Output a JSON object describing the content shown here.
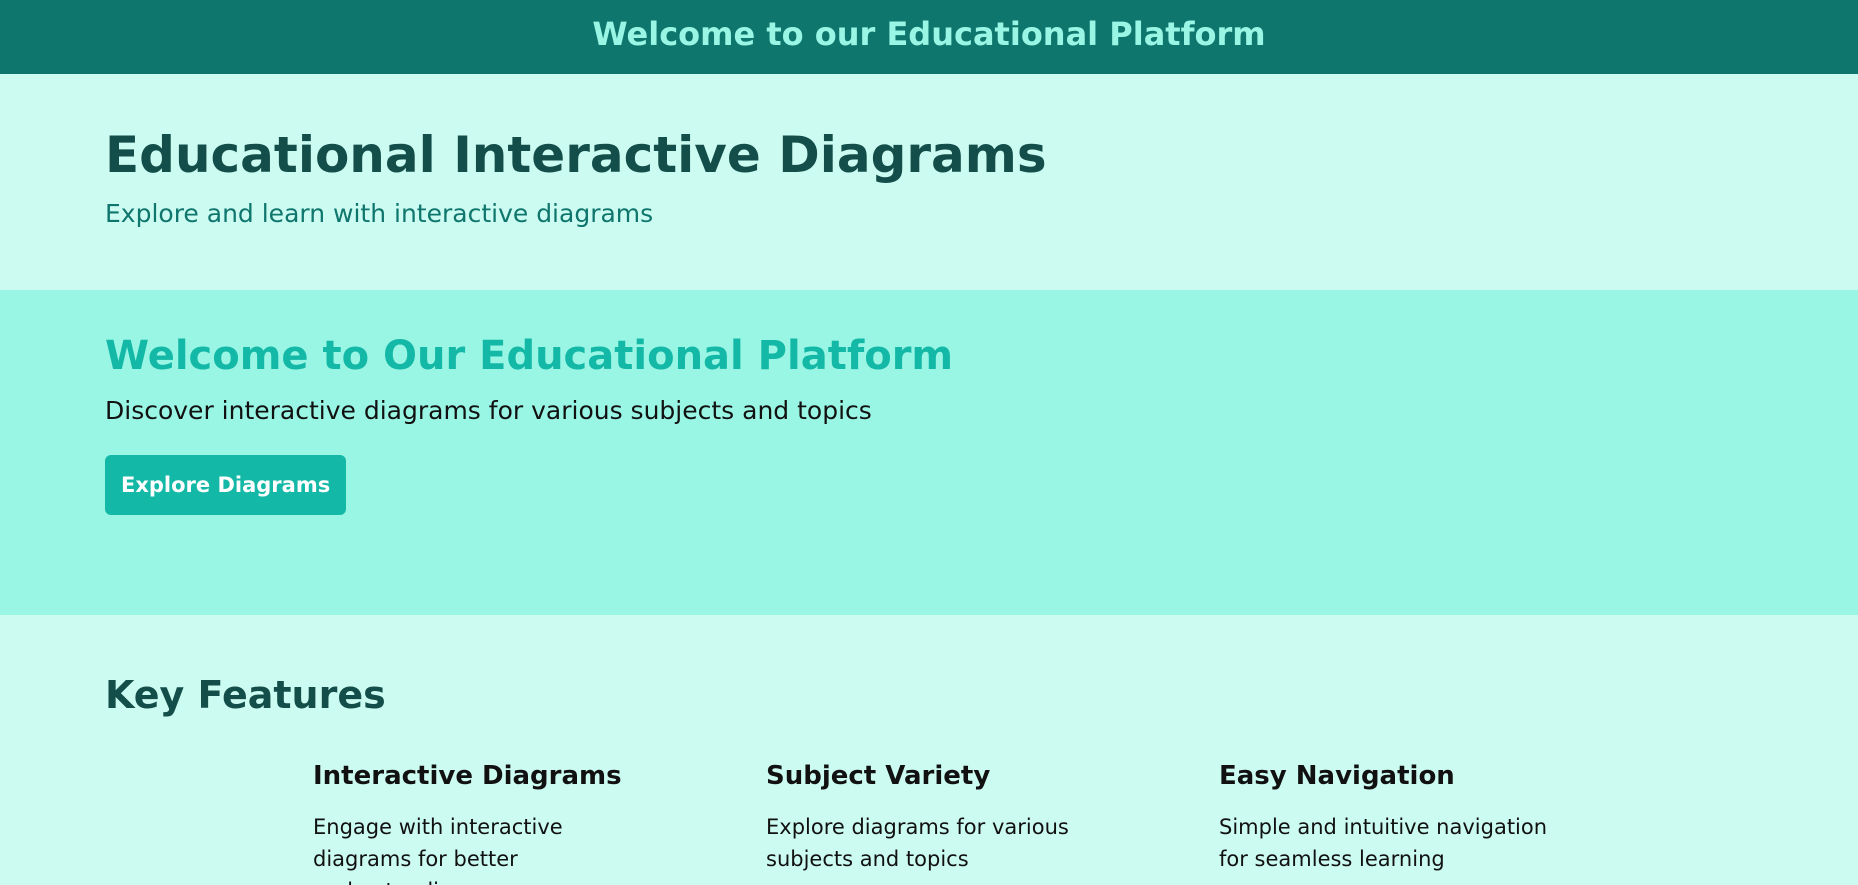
{
  "topbar": {
    "title": "Welcome to our Educational Platform"
  },
  "header": {
    "title": "Educational Interactive Diagrams",
    "subtitle": "Explore and learn with interactive diagrams"
  },
  "hero": {
    "title": "Welcome to Our Educational Platform",
    "text": "Discover interactive diagrams for various subjects and topics",
    "button_label": "Explore Diagrams"
  },
  "features": {
    "title": "Key Features",
    "items": [
      {
        "title": "Interactive Diagrams",
        "description": "Engage with interactive diagrams for better understanding"
      },
      {
        "title": "Subject Variety",
        "description": "Explore diagrams for various subjects and topics"
      },
      {
        "title": "Easy Navigation",
        "description": "Simple and intuitive navigation for seamless learning"
      }
    ]
  },
  "colors": {
    "topbar_bg": "#0f766e",
    "topbar_text": "#99f6e4",
    "page_bg": "#ccfbf1",
    "hero_bg": "#99f6e4",
    "accent": "#14b8a6",
    "heading_dark": "#134e4a"
  }
}
